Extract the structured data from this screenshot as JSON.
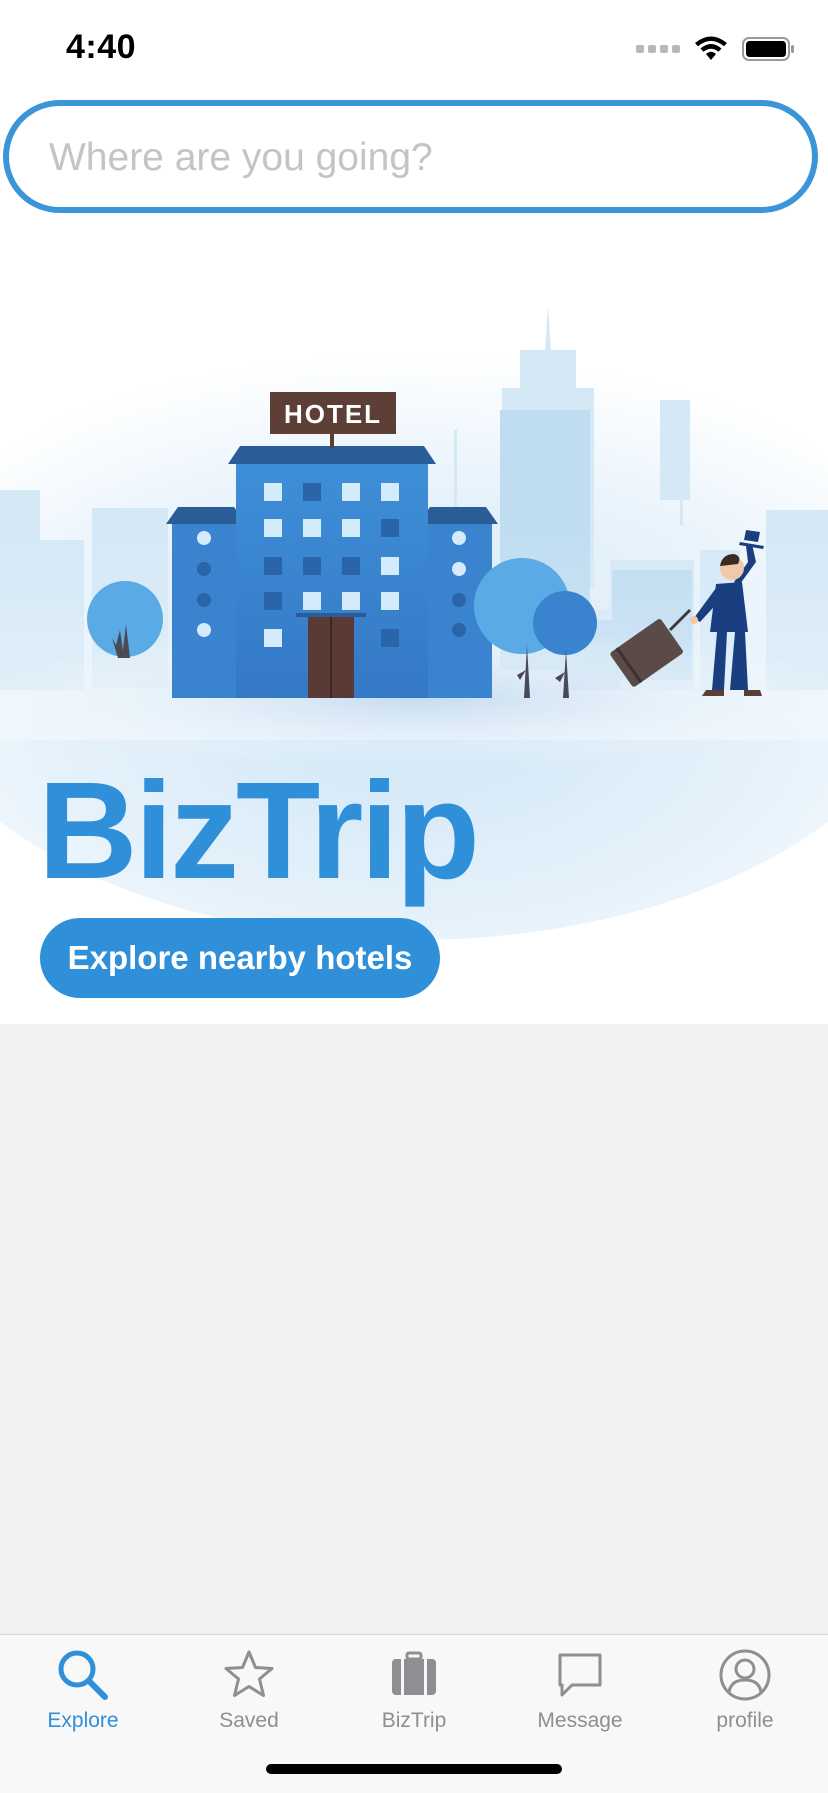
{
  "status_bar": {
    "time": "4:40"
  },
  "search": {
    "placeholder": "Where are you going?",
    "value": ""
  },
  "hero": {
    "sign_text": "HOTEL",
    "brand_title": "BizTrip",
    "explore_button_label": "Explore nearby hotels"
  },
  "colors": {
    "accent": "#2f8fd8",
    "search_border": "#3a96d9",
    "content_background": "#f1f1f2",
    "inactive_tab": "#8e8e93"
  },
  "tab_bar": {
    "tabs": [
      {
        "label": "Explore",
        "icon": "search-icon",
        "active": true
      },
      {
        "label": "Saved",
        "icon": "star-icon",
        "active": false
      },
      {
        "label": "BizTrip",
        "icon": "suitcase-icon",
        "active": false
      },
      {
        "label": "Message",
        "icon": "message-icon",
        "active": false
      },
      {
        "label": "profile",
        "icon": "profile-icon",
        "active": false
      }
    ]
  }
}
